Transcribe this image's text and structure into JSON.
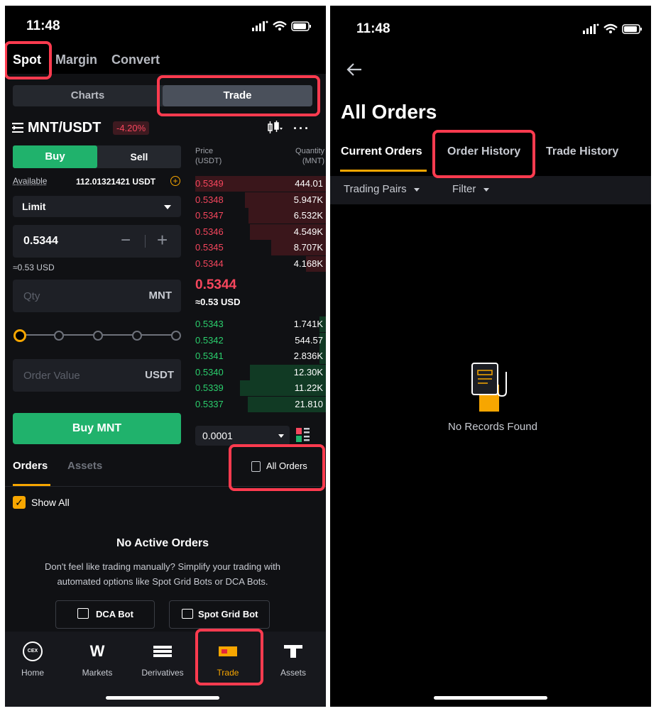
{
  "left": {
    "status": {
      "time": "11:48"
    },
    "top_tabs": [
      "Spot",
      "Margin",
      "Convert"
    ],
    "view_toggle": {
      "charts": "Charts",
      "trade": "Trade"
    },
    "pair": {
      "name": "MNT/USDT",
      "change": "-4.20%"
    },
    "side": {
      "buy": "Buy",
      "sell": "Sell"
    },
    "available": {
      "label": "Available",
      "value": "112.01321421 USDT"
    },
    "order_type": "Limit",
    "price": {
      "value": "0.5344",
      "usd": "≈0.53 USD"
    },
    "qty": {
      "placeholder": "Qty",
      "unit": "MNT"
    },
    "order_value": {
      "placeholder": "Order Value",
      "unit": "USDT"
    },
    "buy_button": "Buy MNT",
    "orderbook": {
      "price_header": "Price",
      "price_unit": "(USDT)",
      "qty_header": "Quantity",
      "qty_unit": "(MNT)",
      "asks": [
        {
          "price": "0.5349",
          "qty": "444.01",
          "depth": 1.0
        },
        {
          "price": "0.5348",
          "qty": "5.947K",
          "depth": 0.62
        },
        {
          "price": "0.5347",
          "qty": "6.532K",
          "depth": 0.59
        },
        {
          "price": "0.5346",
          "qty": "4.549K",
          "depth": 0.58
        },
        {
          "price": "0.5345",
          "qty": "8.707K",
          "depth": 0.42
        },
        {
          "price": "0.5344",
          "qty": "4.168K",
          "depth": 0.15
        }
      ],
      "mid_price": "0.5344",
      "mid_usd": "≈0.53 USD",
      "bids": [
        {
          "price": "0.5343",
          "qty": "1.741K",
          "depth": 0.05
        },
        {
          "price": "0.5342",
          "qty": "544.57",
          "depth": 0.05
        },
        {
          "price": "0.5341",
          "qty": "2.836K",
          "depth": 0.05
        },
        {
          "price": "0.5340",
          "qty": "12.30K",
          "depth": 0.58
        },
        {
          "price": "0.5339",
          "qty": "11.22K",
          "depth": 0.66
        },
        {
          "price": "0.5337",
          "qty": "21.810",
          "depth": 0.6
        }
      ],
      "precision": "0.0001"
    },
    "orders_tabs": {
      "orders": "Orders",
      "assets": "Assets",
      "all_orders": "All Orders"
    },
    "show_all": "Show All",
    "empty": {
      "title": "No Active Orders",
      "text": "Don't feel like trading manually? Simplify your trading with automated options like Spot Grid Bots or DCA Bots."
    },
    "bots": {
      "dca": "DCA Bot",
      "grid": "Spot Grid Bot"
    },
    "nav": [
      {
        "label": "Home",
        "icon": "cex-home-icon"
      },
      {
        "label": "Markets",
        "icon": "markets-icon"
      },
      {
        "label": "Derivatives",
        "icon": "derivatives-icon"
      },
      {
        "label": "Trade",
        "icon": "trade-icon"
      },
      {
        "label": "Assets",
        "icon": "assets-icon"
      }
    ],
    "nav_cex": "CEX",
    "colors": {
      "accent": "#f7a600",
      "buy": "#20b26c",
      "sell": "#f6465d"
    }
  },
  "right": {
    "status": {
      "time": "11:48"
    },
    "title": "All Orders",
    "tabs": [
      "Current Orders",
      "Order History",
      "Trade History"
    ],
    "filters": {
      "pairs": "Trading Pairs",
      "filter": "Filter"
    },
    "empty": "No Records Found"
  }
}
